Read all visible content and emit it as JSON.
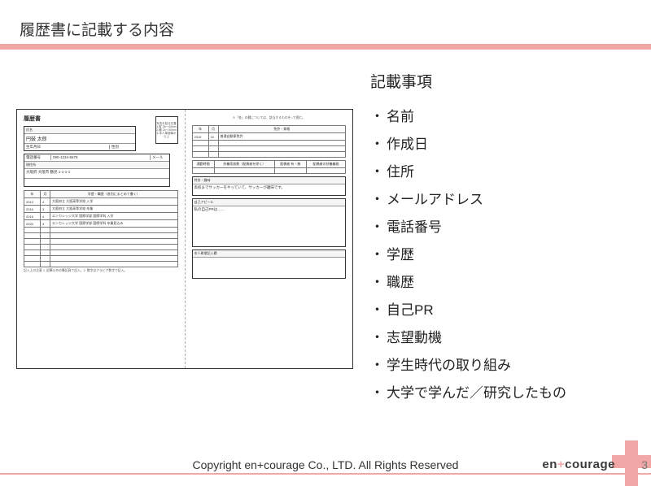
{
  "title": "履歴書に記載する内容",
  "list_title": "記載事項",
  "items": [
    "名前",
    "作成日",
    "住所",
    "メールアドレス",
    "電話番号",
    "学歴",
    "職歴",
    "自己PR",
    "志望動機",
    "学生時代の取り組み",
    "大学で学んだ／研究したもの"
  ],
  "form": {
    "doc_title": "履歴書",
    "photo_note": "写真を貼る位置\n1.縦 36〜40mm\n2.横 24〜30mm\n3.本人単身胸から上",
    "name_label": "氏名",
    "name_value": "円鼓 太郎",
    "birth_label": "生年月日",
    "gender_label": "性別",
    "phone_label": "電話番号",
    "phone_value": "090-1234-5678",
    "email_label": "メール",
    "address_label": "現住所",
    "address_value": "大阪府 大阪市 鶴見  1-1-1-1",
    "edu_header": "学歴・職歴（各別にまとめて書く）",
    "edu_rows": [
      {
        "y": "2013",
        "m": "4",
        "t": "大阪府立 大阪高等学校 入学"
      },
      {
        "y": "2016",
        "m": "3",
        "t": "大阪府立 大阪高等学校 卒業"
      },
      {
        "y": "2016",
        "m": "4",
        "t": "エンカレッジ大学 国際学部 国際学科 入学"
      },
      {
        "y": "2020",
        "m": "3",
        "t": "エンカレッジ大学 国際学部 国際学科 卒業見込み"
      }
    ],
    "right_note": "※「各」の欄については、該当するものを○で囲む。",
    "cert_header": "免許・資格",
    "cert_rows": [
      {
        "y": "2019",
        "m": "10",
        "t": "普通自動車免許"
      }
    ],
    "commute_labels": [
      "通勤時間",
      "扶養家族数（配偶者を除く）",
      "配偶者 有・無",
      "配偶者の扶養義務"
    ],
    "hobby_label": "特技・趣味",
    "hobby_value": "高校までサッカーをやっていて、サッカーが趣味です。",
    "pr_label": "自己アピール",
    "pr_value": "私の自己PRは……",
    "wish_label": "本人希望記入欄",
    "footnote": "記入上の注意 1. 鉛筆以外の筆記具で記入。2. 数字はアラビア数字で記入。"
  },
  "footer": {
    "copyright": "Copyright en+courage Co., LTD. All Rights Reserved",
    "brand_a": "en",
    "brand_plus": "+",
    "brand_b": "courage",
    "page": "3"
  }
}
